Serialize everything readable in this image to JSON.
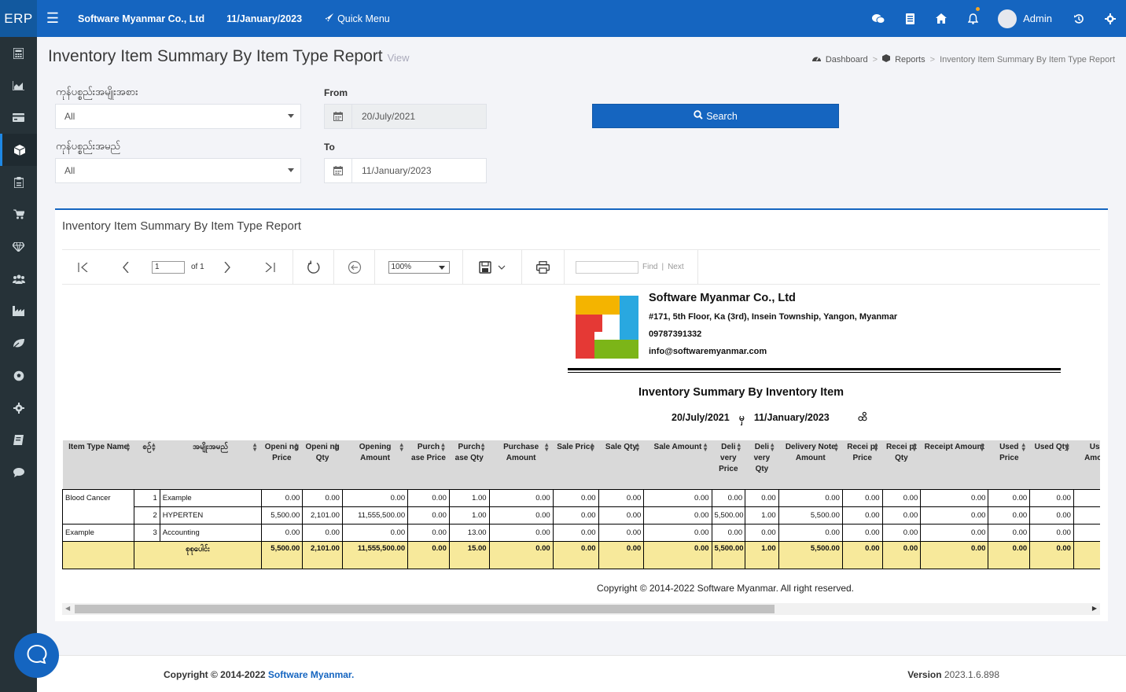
{
  "topbar": {
    "brand": "ERP",
    "company": "Software Myanmar Co., Ltd",
    "date": "11/January/2023",
    "quick_menu": "Quick Menu",
    "user": "Admin",
    "accent": "#1565c0"
  },
  "sidebar": {
    "icons": [
      "calculator-icon",
      "chart-area-icon",
      "credit-card-icon",
      "cube-icon",
      "clipboard-icon",
      "cart-icon",
      "diamond-icon",
      "users-icon",
      "industry-icon",
      "leaf-icon",
      "soccer-ball-icon",
      "gear-icon",
      "book-icon",
      "comment-icon"
    ],
    "active_index": 3
  },
  "page": {
    "title": "Inventory Item Summary By Item Type Report",
    "subtitle": "View",
    "breadcrumb": [
      "Dashboard",
      "Reports",
      "Inventory Item Summary By Item Type Report"
    ]
  },
  "filters": {
    "item_type_label": "ကုန်ပစ္စည်းအမျိုးအစား",
    "item_type_value": "All",
    "item_name_label": "ကုန်ပစ္စည်းအမည်",
    "item_name_value": "All",
    "from_label": "From",
    "from_value": "20/July/2021",
    "to_label": "To",
    "to_value": "11/January/2023",
    "search_label": "Search"
  },
  "report": {
    "card_title": "Inventory Item Summary By Item Type Report",
    "toolbar": {
      "page_value": "1",
      "page_of": "of 1",
      "zoom": "100%",
      "find_label": "Find",
      "next_label": "Next"
    },
    "company": {
      "name": "Software Myanmar Co., Ltd",
      "address": "#171, 5th Floor, Ka (3rd), Insein Township, Yangon, Myanmar",
      "phone": "09787391332",
      "email": "info@softwaremyanmar.com"
    },
    "title": "Inventory Summary By Inventory Item",
    "from_date": "20/July/2021",
    "mid_word": "မှ",
    "to_date": "11/January/2023",
    "end_word": "ထိ",
    "headers": [
      "Item Type Name",
      "စဉ်",
      "အမျိုးအမည်",
      "Openi ng Price",
      "Openi ng Qty",
      "Opening Amount",
      "Purch ase Price",
      "Purch ase Qty",
      "Purchase Amount",
      "Sale Price",
      "Sale Qty",
      "Sale Amount",
      "Deli very Price",
      "Deli very Qty",
      "Delivery Note Amount",
      "Recei pt Price",
      "Recei pt Qty",
      "Receipt Amount",
      "Used Price",
      "Used Qty",
      "Used Amount"
    ],
    "rows": [
      {
        "type": "Blood Cancer",
        "no": "1",
        "name": "Example",
        "vals": [
          "0.00",
          "0.00",
          "0.00",
          "0.00",
          "1.00",
          "0.00",
          "0.00",
          "0.00",
          "0.00",
          "0.00",
          "0.00",
          "0.00",
          "0.00",
          "0.00",
          "0.00",
          "0.00",
          "0.00",
          ""
        ]
      },
      {
        "type": "",
        "no": "2",
        "name": "HYPERTEN",
        "vals": [
          "5,500.00",
          "2,101.00",
          "11,555,500.00",
          "0.00",
          "1.00",
          "0.00",
          "0.00",
          "0.00",
          "0.00",
          "5,500.00",
          "1.00",
          "5,500.00",
          "0.00",
          "0.00",
          "0.00",
          "0.00",
          "0.00",
          ""
        ]
      },
      {
        "type": "Example",
        "no": "3",
        "name": "Accounting",
        "vals": [
          "0.00",
          "0.00",
          "0.00",
          "0.00",
          "13.00",
          "0.00",
          "0.00",
          "0.00",
          "0.00",
          "0.00",
          "0.00",
          "0.00",
          "0.00",
          "0.00",
          "0.00",
          "0.00",
          "0.00",
          ""
        ]
      }
    ],
    "total": {
      "label": "စုစုပေါင်း",
      "vals": [
        "5,500.00",
        "2,101.00",
        "11,555,500.00",
        "0.00",
        "15.00",
        "0.00",
        "0.00",
        "0.00",
        "0.00",
        "5,500.00",
        "1.00",
        "5,500.00",
        "0.00",
        "0.00",
        "0.00",
        "0.00",
        "0.00",
        ""
      ]
    },
    "copyright": "Copyright © 2014-2022 Software Myanmar. All right reserved."
  },
  "footer": {
    "copyright_prefix": "Copyright © 2014-2022",
    "brand": "Software Myanmar.",
    "version_label": "Version",
    "version": "2023.1.6.898"
  }
}
